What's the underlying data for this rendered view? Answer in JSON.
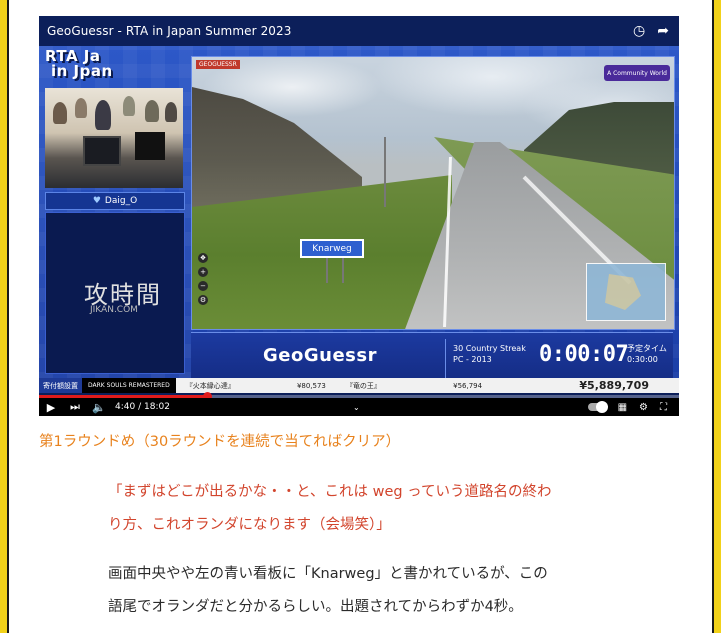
{
  "video": {
    "title": "GeoGuessr - RTA in Japan Summer 2023",
    "icons": [
      "clock-icon",
      "share-icon"
    ],
    "logo": {
      "line1": "RTA Ja",
      "line2": "in Jpan"
    },
    "handle": "Daig_O",
    "side_panel_text": "攻時間",
    "side_panel_small": "JIKAN.COM",
    "game": {
      "badge": "GEOGUESSR",
      "community": "A Community World",
      "sign_text": "Knarweg"
    },
    "scoreboard": {
      "game_name": "GeoGuessr",
      "category": "30 Country Streak",
      "platform": "PC - 2013",
      "timer": "0:00:07",
      "estimate_label": "予定タイム",
      "estimate": "0:30:00"
    },
    "ticker": {
      "left": "寄付額設置",
      "mid_top": "DARK SOULS REMASTERED",
      "mid_bottom": "ランキング予想",
      "item1_label": "『火本縁心達』",
      "item1_amount": "¥80,573",
      "item2_label": "『竜の王』",
      "item2_amount": "¥56,794",
      "total": "¥5,889,709"
    },
    "player": {
      "current_time": "4:40",
      "duration": "18:02",
      "progress": 0.262
    }
  },
  "article": {
    "caption": "第1ラウンドめ（30ラウンドを連続で当てればクリア）",
    "quote_line1": "「まずはどこが出るかな・・と、これは weg っていう道路名の終わ",
    "quote_line2": "り方、これオランダになります（会場笑）」",
    "body_line1": "画面中央やや左の青い看板に「Knarweg」と書かれているが、この",
    "body_line2": "語尾でオランダだと分かるらしい。出題されてからわずか4秒。"
  },
  "colors": {
    "frame": "#f2d21a",
    "caption": "#e8821d",
    "quote": "#d2452d",
    "progress": "#e01b1b"
  }
}
